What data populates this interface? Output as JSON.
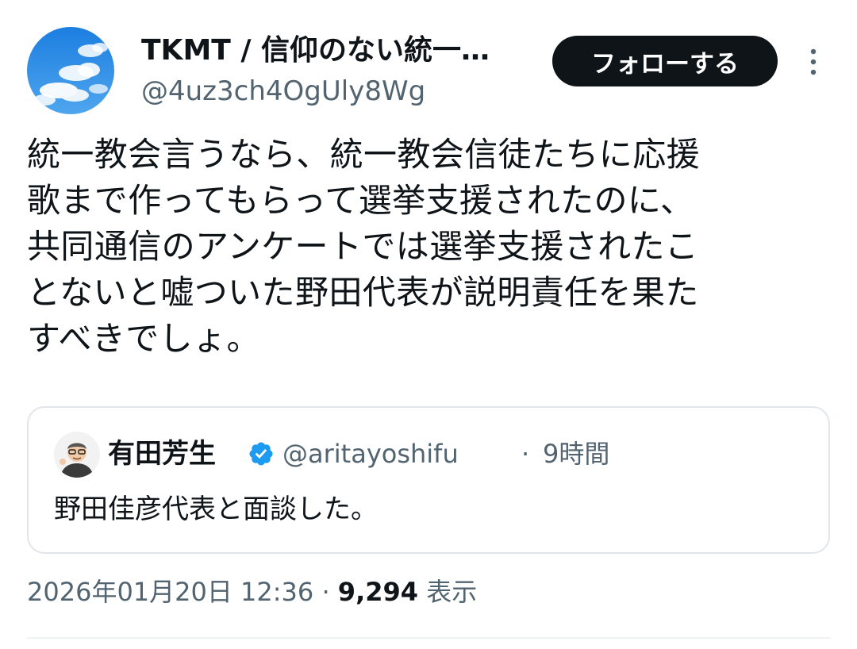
{
  "author": {
    "display_name": "TKMT / 信仰のない統一…",
    "handle": "@4uz3ch4OgUly8Wg",
    "avatar_icon": "sky-clouds-avatar"
  },
  "follow_button": {
    "label": "フォローする"
  },
  "more_menu": {
    "icon": "more-vertical-icon"
  },
  "tweet": {
    "lines": [
      "統一教会言うなら、統一教会信徒たちに応援",
      "歌まで作ってもらって選挙支援されたのに、",
      "共同通信のアンケートでは選挙支援されたこ",
      "とないと嘘ついた野田代表が説明責任を果た",
      "すべきでしょ。"
    ]
  },
  "quote": {
    "display_name": "有田芳生",
    "verified_icon": "verified-badge-icon",
    "handle": "@aritayoshifu",
    "separator": "·",
    "time": "9時間",
    "text": "野田佳彦代表と面談した。"
  },
  "meta": {
    "timestamp": "2026年01月20日 12:36",
    "separator": "·",
    "views_count": "9,294",
    "views_label": "表示"
  },
  "colors": {
    "text_primary": "#0f1419",
    "text_secondary": "#536471",
    "button_bg": "#0f1419",
    "verified": "#1d9bf0",
    "border": "#e2e6ea"
  }
}
